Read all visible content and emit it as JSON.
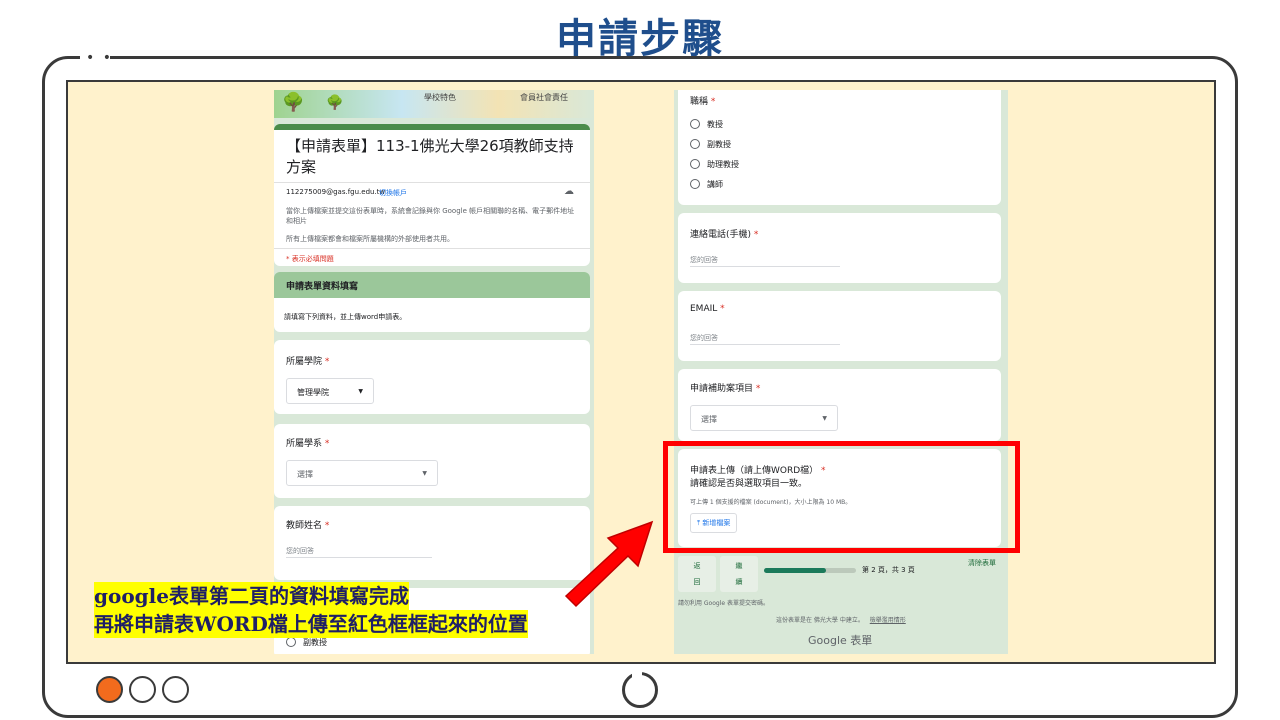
{
  "slide": {
    "title": "申請步驟",
    "caption_line1": "google表單第二頁的資料填寫完成",
    "caption_line2": "再將申請表WORD檔上傳至紅色框框起來的位置"
  },
  "left_form": {
    "banner_texts": [
      "學校特色",
      "會員社會責任"
    ],
    "form_title": "【申請表單】113-1佛光大學26項教師支持方案",
    "account_email": "112275009@gas.fgu.edu.tw",
    "switch_account": "切換帳戶",
    "notice_1": "當你上傳檔案並提交這份表單時，系統會記錄與你 Google 帳戶相關聯的名稱、電子郵件地址和相片",
    "notice_2": "所有上傳檔案都會和檔案所屬機構的外部使用者共用。",
    "required_note": "* 表示必填問題",
    "section_title": "申請表單資料填寫",
    "section_desc": "請填寫下列資料，並上傳word申請表。",
    "q_college": "所屬學院",
    "college_value": "管理學院",
    "q_department": "所屬學系",
    "department_value": "選擇",
    "q_teacher_name": "教師姓名",
    "answer_placeholder": "您的回答",
    "bottom_option": "副教授"
  },
  "right_form": {
    "q_title": "職稱",
    "title_options": [
      "教授",
      "副教授",
      "助理教授",
      "講師"
    ],
    "q_phone": "連絡電話(手機)",
    "phone_placeholder": "您的回答",
    "q_email": "EMAIL",
    "email_placeholder": "您的回答",
    "q_item": "申請補助案項目",
    "item_value": "選擇",
    "q_upload": "申請表上傳（請上傳WORD檔）",
    "upload_desc": "請確認是否與選取項目一致。",
    "upload_limit": "可上傳 1 個支援的檔案 (document)，大小上限為 10 MB。",
    "add_file": "新增檔案",
    "btn_back_1": "返",
    "btn_back_2": "回",
    "btn_next_1": "繼",
    "btn_next_2": "續",
    "page_info": "第 2 頁，共 3 頁",
    "page_progress": 0.67,
    "clear_form": "清除表單",
    "never_submit": "請勿利用 Google 表單提交密碼。",
    "footer_note": "這份表單是在 佛光大學 中建立。",
    "report_abuse": "檢舉濫用情形",
    "brand": "Google 表單"
  },
  "colors": {
    "title_blue": "#1f4e8c",
    "screen_bg": "#fff2cc",
    "form_bg": "#d9e8d8",
    "highlight": "#ff0000",
    "caption_bg": "#ffff00",
    "active_dot": "#f26b1d"
  }
}
